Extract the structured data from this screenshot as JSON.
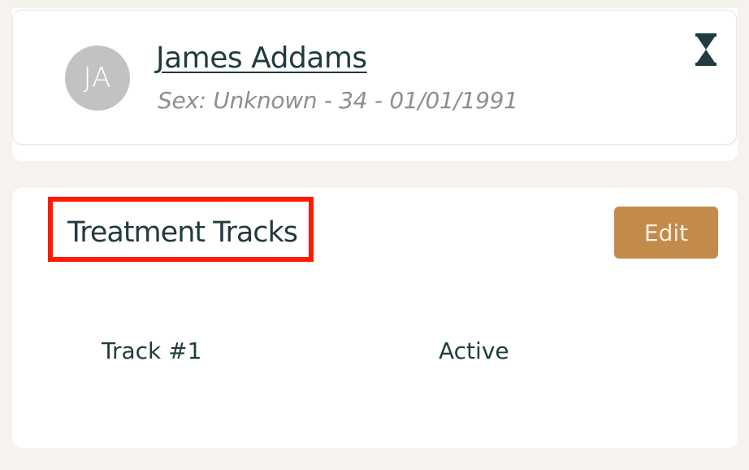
{
  "patient": {
    "initials": "JA",
    "name": "James Addams",
    "meta": "Sex: Unknown - 34 - 01/01/1991",
    "status_icon": "hourglass-icon"
  },
  "tracks": {
    "title": "Treatment Tracks",
    "edit_label": "Edit",
    "items": [
      {
        "name": "Track #1",
        "status": "Active"
      }
    ]
  },
  "colors": {
    "page_background": "#f6f3ef",
    "primary_text": "#1f3b3f",
    "accent_button": "#c38b4a",
    "highlight_border": "#ff1a00",
    "avatar_background": "#c2c2c2"
  }
}
